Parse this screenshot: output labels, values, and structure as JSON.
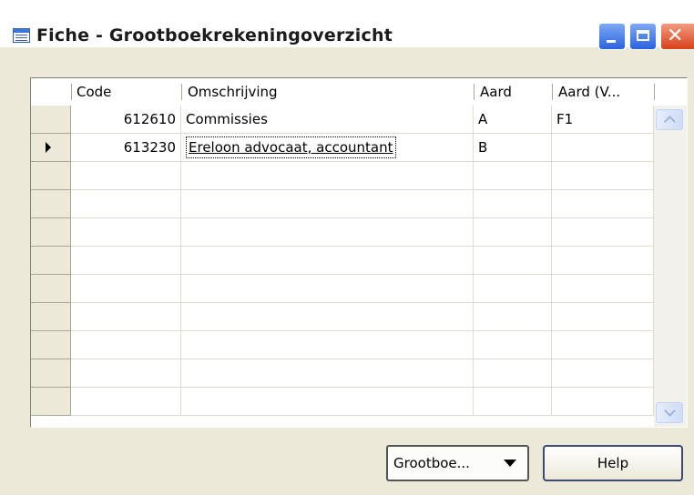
{
  "window": {
    "title": "Fiche - Grootboekrekeningoverzicht"
  },
  "grid": {
    "columns": [
      "Code",
      "Omschrijving",
      "Aard",
      "Aard (V..."
    ],
    "rows": [
      {
        "code": "612610",
        "description": "Commissies",
        "aard": "A",
        "aard_v": "F1",
        "current": false
      },
      {
        "code": "613230",
        "description": "Ereloon advocaat, accountant",
        "aard": "B",
        "aard_v": "",
        "current": true
      },
      {
        "code": "",
        "description": "",
        "aard": "",
        "aard_v": "",
        "current": false
      },
      {
        "code": "",
        "description": "",
        "aard": "",
        "aard_v": "",
        "current": false
      },
      {
        "code": "",
        "description": "",
        "aard": "",
        "aard_v": "",
        "current": false
      },
      {
        "code": "",
        "description": "",
        "aard": "",
        "aard_v": "",
        "current": false
      },
      {
        "code": "",
        "description": "",
        "aard": "",
        "aard_v": "",
        "current": false
      },
      {
        "code": "",
        "description": "",
        "aard": "",
        "aard_v": "",
        "current": false
      },
      {
        "code": "",
        "description": "",
        "aard": "",
        "aard_v": "",
        "current": false
      },
      {
        "code": "",
        "description": "",
        "aard": "",
        "aard_v": "",
        "current": false
      },
      {
        "code": "",
        "description": "",
        "aard": "",
        "aard_v": "",
        "current": false
      }
    ]
  },
  "footer": {
    "menu_button_label": "Grootboe...",
    "help_button_label": "Help"
  }
}
